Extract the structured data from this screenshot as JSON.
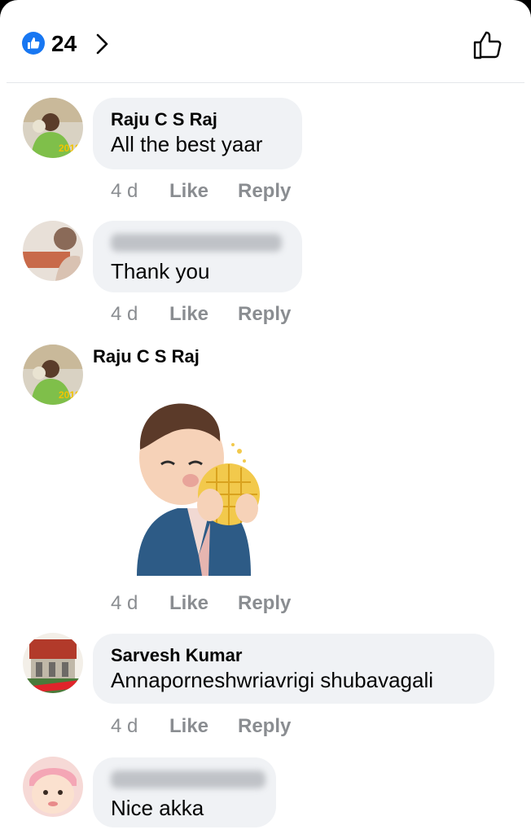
{
  "header": {
    "reaction_count": "24",
    "reaction_icon": "like-badge-icon",
    "chevron_icon": "chevron-right-icon",
    "like_button_icon": "thumbs-up-outline-icon"
  },
  "colors": {
    "accent": "#1877f2",
    "bubble": "#f0f2f5",
    "meta_text": "#8a8d91"
  },
  "comments": [
    {
      "author": "Raju C S Raj",
      "text": "All the best yaar",
      "time": "4 d",
      "like": "Like",
      "reply": "Reply"
    },
    {
      "author": "",
      "text": "Thank you",
      "time": "4 d",
      "like": "Like",
      "reply": "Reply"
    },
    {
      "author": "Raju C S Raj",
      "text": "",
      "time": "4 d",
      "like": "Like",
      "reply": "Reply",
      "attachment": "sticker-boy-eating-biscuit"
    },
    {
      "author": "Sarvesh Kumar",
      "text": "Annaporneshwriavrigi shubavagali",
      "time": "4 d",
      "like": "Like",
      "reply": "Reply"
    },
    {
      "author": "",
      "text": "Nice akka"
    }
  ]
}
